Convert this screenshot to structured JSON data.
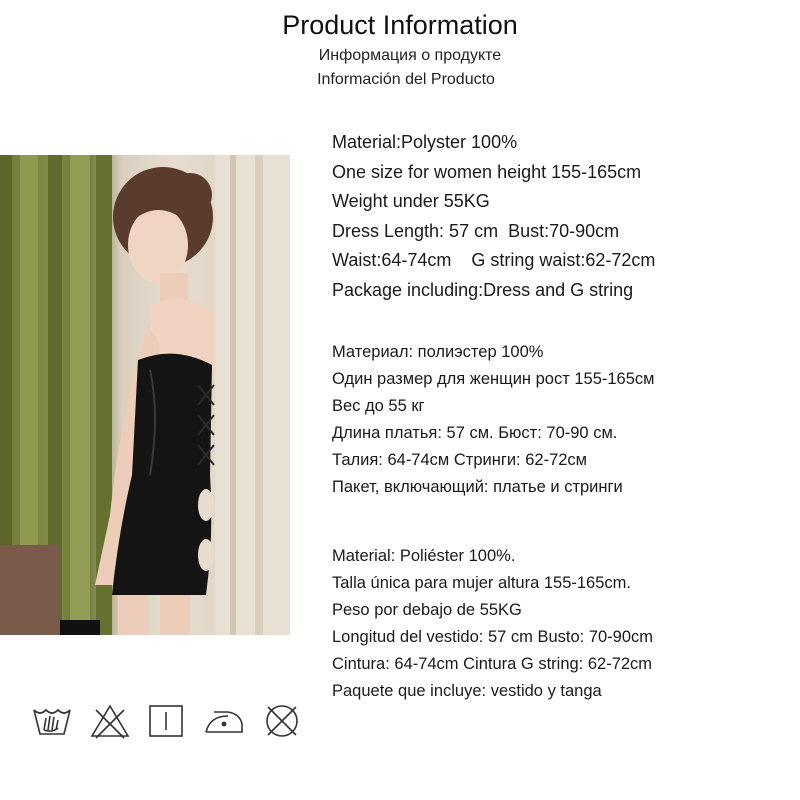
{
  "header": {
    "title": "Product Information",
    "subtitle_ru": "Информация о продукте",
    "subtitle_es": "Información del Producto"
  },
  "english": [
    "Material:Polyster 100%",
    "One size for women height 155-165cm",
    "Weight under 55KG",
    "Dress Length: 57 cm  Bust:70-90cm",
    "Waist:64-74cm    G string waist:62-72cm",
    "Package including:Dress and G string"
  ],
  "russian": [
    "Материал: полиэстер 100%",
    "Один размер для женщин рост 155-165см",
    "Вес до 55 кг",
    "Длина платья: 57 см. Бюст: 70-90 см.",
    "Талия: 64-74см Стринги: 62-72см",
    "Пакет, включающий: платье и стринги"
  ],
  "spanish": [
    "Material: Poliéster 100%.",
    "Talla única para mujer altura 155-165cm.",
    "Peso por debajo de 55KG",
    "Longitud del vestido: 57 cm Busto: 70-90cm",
    "Cintura: 64-74cm Cintura G string: 62-72cm",
    "Paquete que incluye: vestido y tanga"
  ],
  "care_icons": [
    "hand-wash-icon",
    "do-not-bleach-icon",
    "tumble-dry-icon",
    "iron-low-icon",
    "do-not-dry-clean-icon"
  ],
  "colors": {
    "text": "#1a1a1a",
    "curtain": "#6f7a3a",
    "dress": "#121212"
  }
}
